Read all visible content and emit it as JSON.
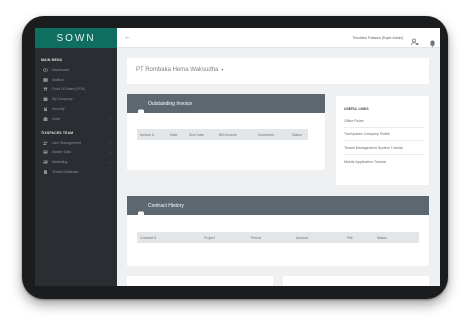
{
  "app": {
    "logo": "SOWN"
  },
  "sidebar": {
    "main_menu_title": "MAIN MENU",
    "main_items": [
      {
        "label": "Dashboard",
        "icon": "eye-icon"
      },
      {
        "label": "Mailbox",
        "icon": "mailbox-icon"
      },
      {
        "label": "Point Of Sales (POS)",
        "icon": "pos-icon"
      },
      {
        "label": "My Company",
        "icon": "company-icon"
      },
      {
        "label": "Security",
        "icon": "lock-icon"
      },
      {
        "label": "Hotel",
        "icon": "hotel-icon",
        "has_children": true
      }
    ],
    "team_title": "TIXSPACES TEAM",
    "team_items": [
      {
        "label": "User Management",
        "icon": "users-icon",
        "has_children": true
      },
      {
        "label": "Master Data",
        "icon": "database-icon",
        "has_children": true
      },
      {
        "label": "Marketing",
        "icon": "marketing-icon",
        "has_children": true
      },
      {
        "label": "Tenant Database",
        "icon": "tenant-database-icon"
      }
    ]
  },
  "topbar": {
    "back_icon": "arrow-left-icon",
    "user_name": "Timothius Pratama [Super Admin]",
    "user_icon": "user-settings-icon",
    "bell_icon": "bell-icon"
  },
  "company_selector": {
    "name": "PT Rombaka Hema Waksudha",
    "caret": "▾"
  },
  "outstanding_invoice": {
    "title": "Outstanding Invoice",
    "columns": [
      "Invoice #",
      "Date",
      "Due Date",
      "Bill Amount",
      "Document",
      "Status"
    ]
  },
  "useful_links": {
    "title": "USEFUL LINKS",
    "items": [
      "Office Rules",
      "TixsSpaces Company Profile",
      "Tenant Management System Tutorial",
      "Mobile Application Tutorial"
    ]
  },
  "contract_history": {
    "title": "Contract History",
    "columns": [
      "Contract #",
      "Project",
      "Period",
      "Amount",
      "File",
      "Status"
    ]
  },
  "colors": {
    "brand": "#0f6e60",
    "sidebar": "#2a2d31",
    "panel_header": "#5c6770",
    "background": "#eef0f2"
  }
}
